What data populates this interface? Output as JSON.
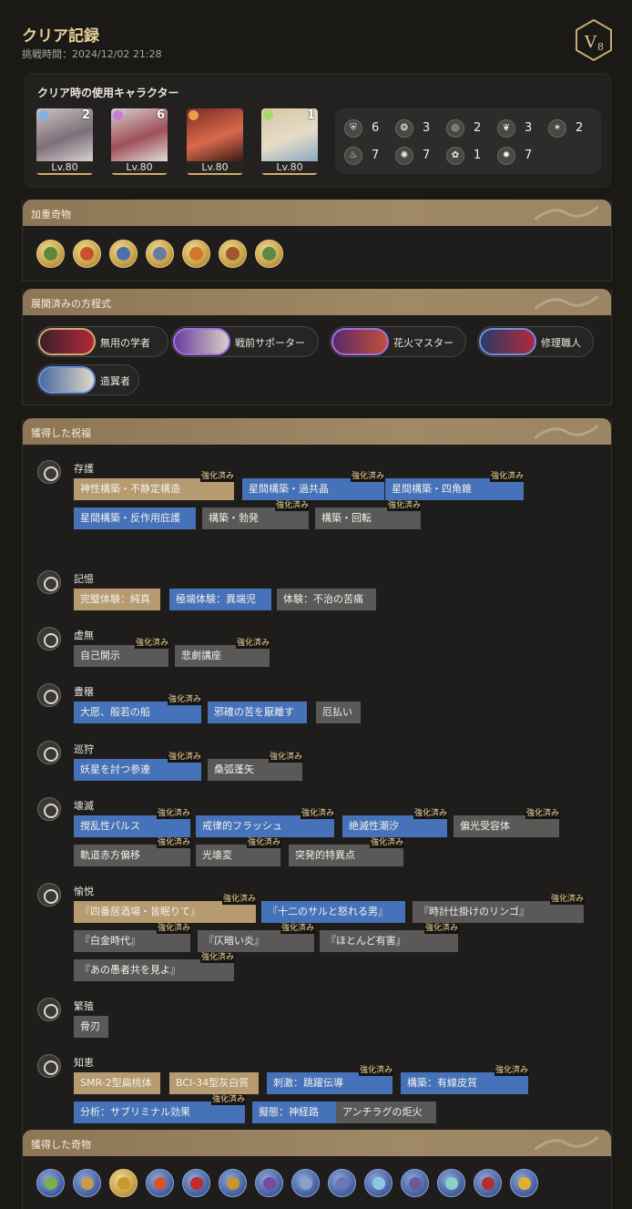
{
  "header": {
    "title": "クリア記録",
    "challenge_time": "挑戦時間：2024/12/02 21:28",
    "difficulty_badge": "V",
    "difficulty_level": "8"
  },
  "characters": {
    "heading": "クリア時の使用キャラクター",
    "list": [
      {
        "level": "Lv.80",
        "count": "2",
        "portrait_colors": [
          "#c9c3c0",
          "#7d6f7a",
          "#d8d1cf"
        ],
        "element_color": "#7db3e8"
      },
      {
        "level": "Lv.80",
        "count": "6",
        "portrait_colors": [
          "#d7cfcf",
          "#9e5058",
          "#e2dbda"
        ],
        "element_color": "#c97dd9"
      },
      {
        "level": "Lv.80",
        "count": "",
        "portrait_colors": [
          "#7c2a22",
          "#d86a4b",
          "#3a1a18"
        ],
        "element_color": "#e8a04a"
      },
      {
        "level": "Lv.80",
        "count": "1",
        "portrait_colors": [
          "#d9c7a6",
          "#e6dcc6",
          "#8aa8c4"
        ],
        "element_color": "#a6d86a"
      }
    ],
    "paths": [
      {
        "icon": "preservation-icon",
        "count": "6"
      },
      {
        "icon": "remembrance-icon",
        "count": "3"
      },
      {
        "icon": "nihility-icon",
        "count": "2"
      },
      {
        "icon": "abundance-icon",
        "count": "3"
      },
      {
        "icon": "hunt-icon",
        "count": "2"
      },
      {
        "icon": "destruction-icon",
        "count": "7"
      },
      {
        "icon": "elation-icon",
        "count": "7"
      },
      {
        "icon": "propagation-icon",
        "count": "1"
      },
      {
        "icon": "erudition-icon",
        "count": "7"
      }
    ]
  },
  "weighted_curios": {
    "heading": "加重奇物",
    "items": [
      {
        "icon": "curio-leaf-icon",
        "color": "#5c8a3a"
      },
      {
        "icon": "curio-egg-icon",
        "color": "#c8502a"
      },
      {
        "icon": "curio-cannon-icon",
        "color": "#4b6fa8"
      },
      {
        "icon": "curio-robot-icon",
        "color": "#6a7aa0"
      },
      {
        "icon": "curio-brush-icon",
        "color": "#d0782c"
      },
      {
        "icon": "curio-claw-icon",
        "color": "#a0582c"
      },
      {
        "icon": "curio-orb-icon",
        "color": "#5a8a44"
      }
    ]
  },
  "equations": {
    "heading": "展開済みの方程式",
    "items": [
      {
        "label": "無用の学者",
        "colors": [
          "#3a1f2a",
          "#b02a3a"
        ],
        "border": "#d4a86a"
      },
      {
        "label": "戦前サポーター",
        "colors": [
          "#6a3ea0",
          "#d8cfc4"
        ],
        "border": "#a070e0"
      },
      {
        "label": "花火マスター",
        "colors": [
          "#5a2a6a",
          "#c0503a"
        ],
        "border": "#a070e0"
      },
      {
        "label": "修理職人",
        "colors": [
          "#2a3a6a",
          "#b02a3a"
        ],
        "border": "#6a90e0"
      },
      {
        "label": "造翼者",
        "colors": [
          "#4a6aa0",
          "#e0d8c8"
        ],
        "border": "#6a90e0"
      }
    ]
  },
  "blessings": {
    "heading": "獲得した祝福",
    "enhanced_label": "強化済み",
    "categories": [
      {
        "name": "存護",
        "icon": "preservation-icon",
        "rows": [
          [
            {
              "label": "神性構築・不静定構造",
              "style": "g",
              "enhanced": true
            },
            {
              "label": "星間構築・過共晶",
              "style": "b",
              "enhanced": true
            },
            {
              "label": "星間構築・四角錐",
              "style": "b",
              "enhanced": true
            }
          ],
          [
            {
              "label": "星間構築・反作用庇護",
              "style": "b",
              "enhanced": false
            },
            {
              "label": "構築・勃発",
              "style": "d",
              "enhanced": true
            },
            {
              "label": "構築・回転",
              "style": "d",
              "enhanced": true
            }
          ]
        ]
      },
      {
        "name": "記憶",
        "icon": "remembrance-icon",
        "rows": [
          [
            {
              "label": "完璧体験：純真",
              "style": "g",
              "enhanced": false
            },
            {
              "label": "極端体験：異端児",
              "style": "b",
              "enhanced": false
            },
            {
              "label": "体験：不治の苦痛",
              "style": "d",
              "enhanced": false
            }
          ]
        ]
      },
      {
        "name": "虚無",
        "icon": "nihility-icon",
        "rows": [
          [
            {
              "label": "自己開示",
              "style": "d",
              "enhanced": true
            },
            {
              "label": "悲劇講座",
              "style": "d",
              "enhanced": true
            }
          ]
        ]
      },
      {
        "name": "豊穣",
        "icon": "abundance-icon",
        "rows": [
          [
            {
              "label": "大愿、般若の船",
              "style": "b",
              "enhanced": true
            },
            {
              "label": "邪確の苦を厭離す",
              "style": "b",
              "enhanced": false
            },
            {
              "label": "厄払い",
              "style": "d",
              "enhanced": false
            }
          ]
        ]
      },
      {
        "name": "巡狩",
        "icon": "hunt-icon",
        "rows": [
          [
            {
              "label": "妖星を討つ参連",
              "style": "b",
              "enhanced": true
            },
            {
              "label": "桑弧蓬矢",
              "style": "d",
              "enhanced": true
            }
          ]
        ]
      },
      {
        "name": "壊滅",
        "icon": "destruction-icon",
        "rows": [
          [
            {
              "label": "撹乱性パルス",
              "style": "b",
              "enhanced": true
            },
            {
              "label": "戒律的フラッシュ",
              "style": "b",
              "enhanced": true
            },
            {
              "label": "絶滅性潮汐",
              "style": "b",
              "enhanced": true
            },
            {
              "label": "偏光受容体",
              "style": "d",
              "enhanced": true
            }
          ],
          [
            {
              "label": "軌道赤方偏移",
              "style": "d",
              "enhanced": true
            },
            {
              "label": "光壊変",
              "style": "d",
              "enhanced": true
            },
            {
              "label": "突発的特異点",
              "style": "d",
              "enhanced": true
            }
          ]
        ]
      },
      {
        "name": "愉悦",
        "icon": "elation-icon",
        "rows": [
          [
            {
              "label": "『四番居酒場・皆眠りて』",
              "style": "g",
              "enhanced": true
            },
            {
              "label": "『十二のサルと怒れる男』",
              "style": "b",
              "enhanced": false
            },
            {
              "label": "『時計仕掛けのリンゴ』",
              "style": "d",
              "enhanced": true
            }
          ],
          [
            {
              "label": "『白金時代』",
              "style": "d",
              "enhanced": true
            },
            {
              "label": "『仄暗い炎』",
              "style": "d",
              "enhanced": true
            },
            {
              "label": "『ほとんど有害』",
              "style": "d",
              "enhanced": true
            }
          ],
          [
            {
              "label": "『あの愚者共を見よ』",
              "style": "d",
              "enhanced": true
            }
          ]
        ]
      },
      {
        "name": "繁殖",
        "icon": "propagation-icon",
        "rows": [
          [
            {
              "label": "骨刃",
              "style": "d",
              "enhanced": false
            }
          ]
        ]
      },
      {
        "name": "知恵",
        "icon": "erudition-icon",
        "rows": [
          [
            {
              "label": "SMR-2型扁桃体",
              "style": "g",
              "enhanced": false
            },
            {
              "label": "BCI-34型灰白質",
              "style": "g",
              "enhanced": false
            },
            {
              "label": "刺激：跳躍伝導",
              "style": "b",
              "enhanced": true
            },
            {
              "label": "構築：有線皮質",
              "style": "b",
              "enhanced": true
            }
          ],
          [
            {
              "label": "分析：サブリミナル効果",
              "style": "b",
              "enhanced": true
            },
            {
              "label": "擬態：神経路",
              "style": "b",
              "enhanced": false
            },
            {
              "label": "アンチラグの炬火",
              "style": "d",
              "enhanced": false
            }
          ]
        ]
      }
    ]
  },
  "obtained_curios": {
    "heading": "獲得した奇物",
    "items": [
      {
        "icon": "curio-plant-icon",
        "color": "#7ab04a",
        "tier": "blue"
      },
      {
        "icon": "curio-beetle-icon",
        "color": "#c89a4a",
        "tier": "blue"
      },
      {
        "icon": "curio-coin-icon",
        "color": "#c89a2a",
        "tier": "gold"
      },
      {
        "icon": "curio-lion-icon",
        "color": "#d0582c",
        "tier": "blue"
      },
      {
        "icon": "curio-rose-icon",
        "color": "#c02a2a",
        "tier": "blue"
      },
      {
        "icon": "curio-bread-icon",
        "color": "#c8962a",
        "tier": "blue"
      },
      {
        "icon": "curio-grapes-icon",
        "color": "#7a4aa0",
        "tier": "blue"
      },
      {
        "icon": "curio-dice-icon",
        "color": "#8aa0c8",
        "tier": "blue"
      },
      {
        "icon": "curio-book-icon",
        "color": "#6a78b8",
        "tier": "blue"
      },
      {
        "icon": "curio-crystal-icon",
        "color": "#8ac8e8",
        "tier": "blue"
      },
      {
        "icon": "curio-figure-icon",
        "color": "#6a5a9a",
        "tier": "blue"
      },
      {
        "icon": "curio-cross-icon",
        "color": "#8ad0c8",
        "tier": "blue"
      },
      {
        "icon": "curio-jacket-icon",
        "color": "#b03030",
        "tier": "blue"
      },
      {
        "icon": "curio-bell-icon",
        "color": "#e0b030",
        "tier": "blue"
      }
    ]
  }
}
